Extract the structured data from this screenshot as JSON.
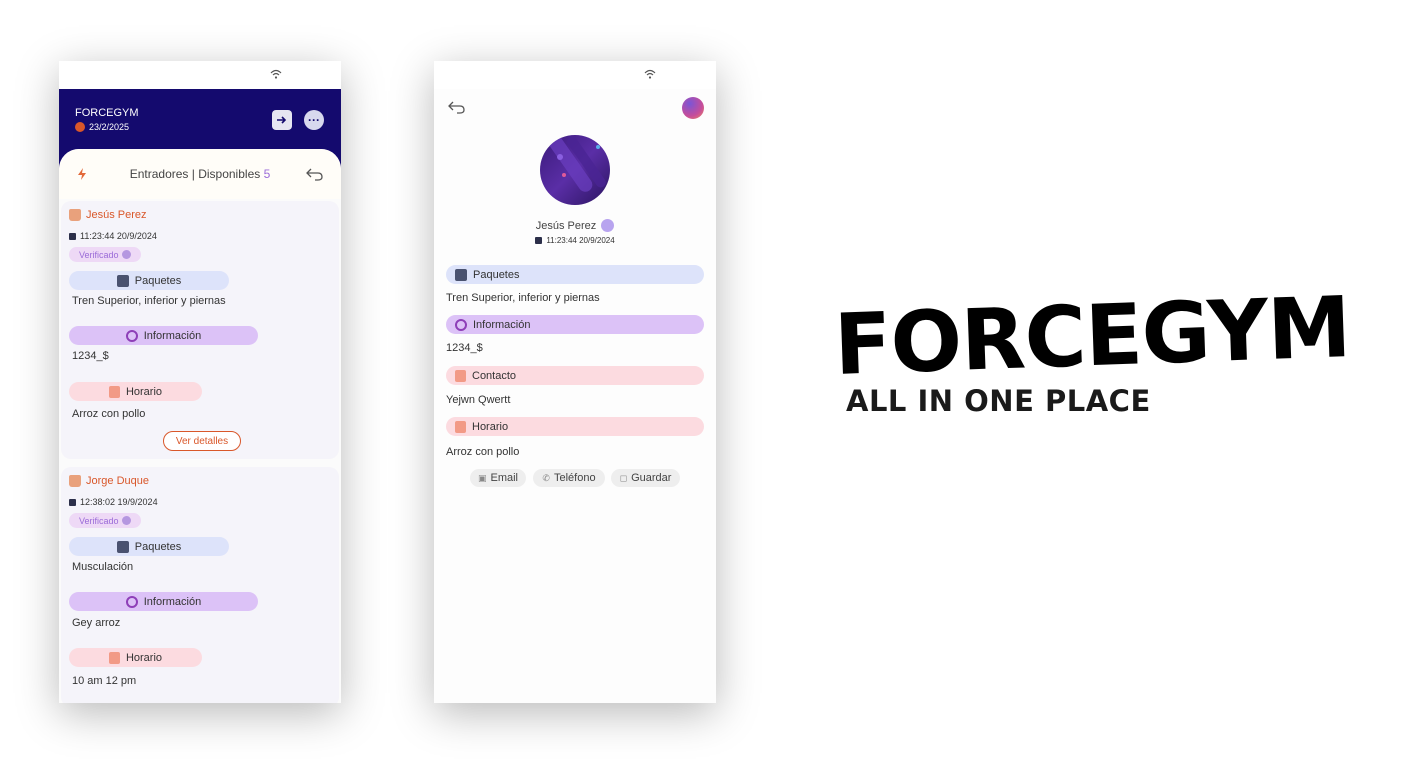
{
  "phone1": {
    "header": {
      "title": "FORCEGYM",
      "date": "23/2/2025"
    },
    "sheet": {
      "title_prefix": "Entradores | Disponibles",
      "count": "5"
    },
    "cards": [
      {
        "name": "Jesús Perez",
        "time": "11:23:44 20/9/2024",
        "verified": "Verificado",
        "paquetes_label": "Paquetes",
        "paquetes_value": "Tren Superior, inferior y piernas",
        "info_label": "Información",
        "info_value": "1234_$",
        "horario_label": "Horario",
        "horario_value": "Arroz con pollo",
        "details_button": "Ver detalles"
      },
      {
        "name": "Jorge Duque",
        "time": "12:38:02 19/9/2024",
        "verified": "Verificado",
        "paquetes_label": "Paquetes",
        "paquetes_value": "Musculación",
        "info_label": "Información",
        "info_value": "Gey arroz",
        "horario_label": "Horario",
        "horario_value": "10 am 12 pm"
      }
    ]
  },
  "phone2": {
    "profile": {
      "name": "Jesús Perez",
      "time": "11:23:44 20/9/2024"
    },
    "sections": {
      "paquetes_label": "Paquetes",
      "paquetes_value": "Tren Superior, inferior y piernas",
      "info_label": "Información",
      "info_value": "1234_$",
      "contacto_label": "Contacto",
      "contacto_value": "Yejwn Qwertt",
      "horario_label": "Horario",
      "horario_value": "Arroz con pollo"
    },
    "actions": {
      "email": "Email",
      "phone": "Teléfono",
      "save": "Guardar"
    }
  },
  "brand": {
    "title": "FORCEGYM",
    "tagline": "ALL IN ONE PLACE"
  },
  "colors": {
    "header": "#140a6e",
    "accent": "#d9572a",
    "count": "#9b6bd8"
  }
}
